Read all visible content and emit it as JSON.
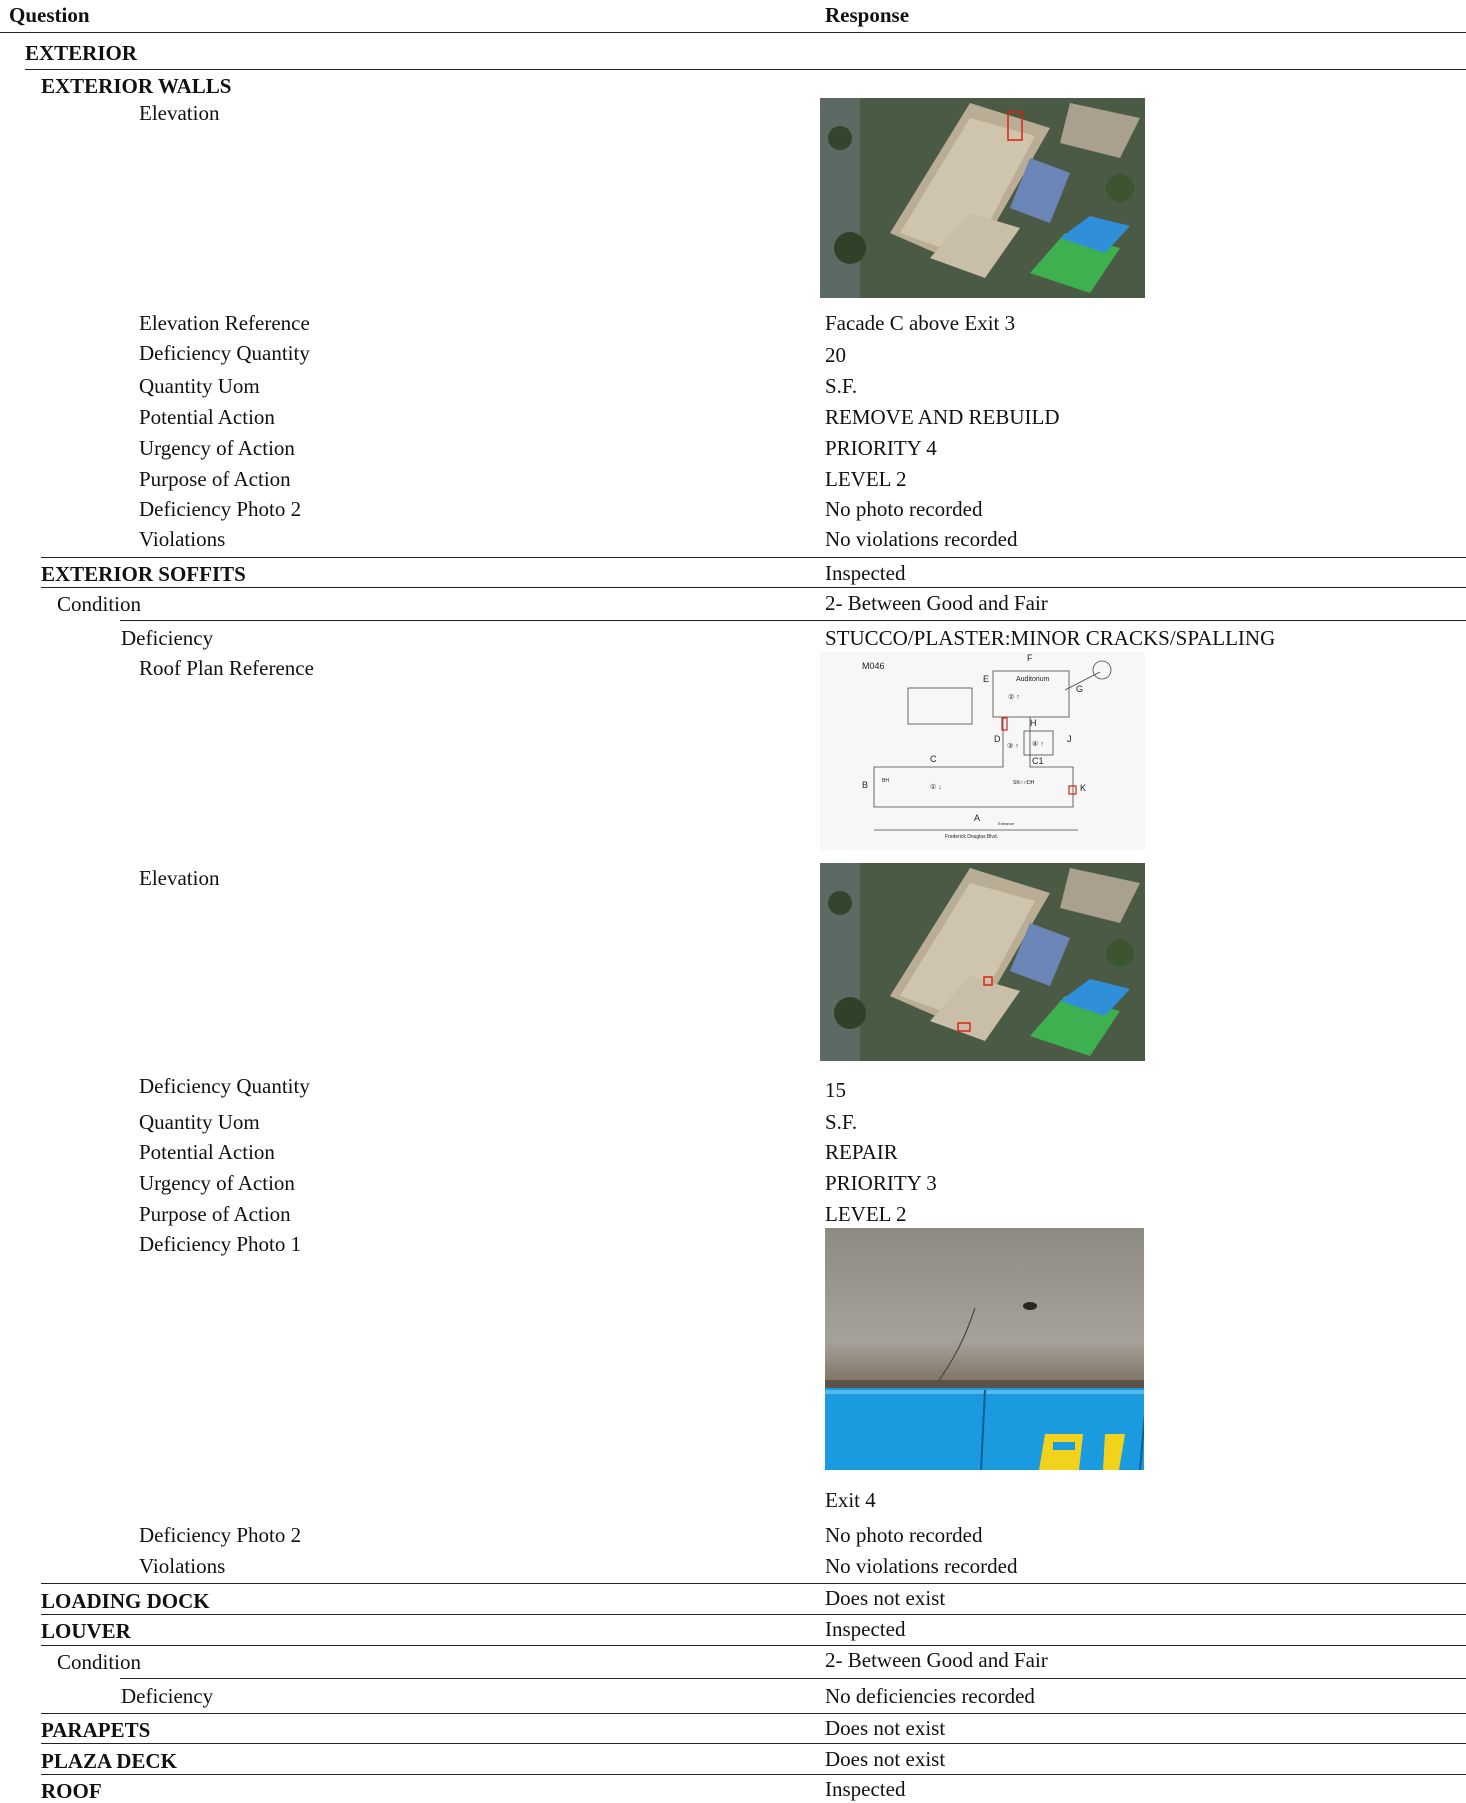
{
  "header": {
    "question": "Question",
    "response": "Response"
  },
  "sections": {
    "exterior": "EXTERIOR",
    "exterior_walls": {
      "title": "EXTERIOR WALLS",
      "elevation_label": "Elevation",
      "elevation_photo_icon": "aerial-photo",
      "fields": [
        {
          "label": "Elevation Reference",
          "value": "Facade C above Exit 3"
        },
        {
          "label": "Deficiency Quantity",
          "value": "20"
        },
        {
          "label": "Quantity Uom",
          "value": "S.F."
        },
        {
          "label": "Potential Action",
          "value": "REMOVE AND REBUILD"
        },
        {
          "label": "Urgency of Action",
          "value": "PRIORITY 4"
        },
        {
          "label": "Purpose of Action",
          "value": "LEVEL 2"
        },
        {
          "label": "Deficiency Photo 2",
          "value": "No photo recorded"
        },
        {
          "label": "Violations",
          "value": "No violations recorded"
        }
      ]
    },
    "exterior_soffits": {
      "title": "EXTERIOR SOFFITS",
      "status": "Inspected",
      "condition_label": "Condition",
      "condition_value": "2- Between Good and Fair",
      "deficiency_label": "Deficiency",
      "deficiency_value": "STUCCO/PLASTER:MINOR CRACKS/SPALLING",
      "roof_plan_label": "Roof Plan Reference",
      "roof_plan": {
        "code": "M046",
        "auditorium": "Auditorium",
        "letters": {
          "F": "F",
          "E": "E",
          "G": "G",
          "H": "H",
          "D": "D",
          "J": "J",
          "C": "C",
          "C1": "C1",
          "B": "B",
          "K": "K",
          "A": "A"
        },
        "bh": "BH",
        "sk": "SK□ □DH",
        "entrance": "Entrance",
        "street": "Frederick Douglas Blvd.",
        "roof_2": "② ↑",
        "roof_3": "③ ↑",
        "roof_4": "④ ↑",
        "roof_1": "① ↓"
      },
      "elevation_label": "Elevation",
      "fields": [
        {
          "label": "Deficiency Quantity",
          "value": "15"
        },
        {
          "label": "Quantity Uom",
          "value": "S.F."
        },
        {
          "label": "Potential Action",
          "value": "REPAIR"
        },
        {
          "label": "Urgency of Action",
          "value": "PRIORITY 3"
        },
        {
          "label": "Purpose of Action",
          "value": "LEVEL 2"
        }
      ],
      "photo1_label": "Deficiency Photo 1",
      "photo1_caption": "Exit 4",
      "photo2_label": "Deficiency Photo 2",
      "photo2_value": "No photo recorded",
      "violations_label": "Violations",
      "violations_value": "No violations recorded"
    },
    "loading_dock": {
      "title": "LOADING DOCK",
      "status": "Does not exist"
    },
    "louver": {
      "title": "LOUVER",
      "status": "Inspected",
      "condition_label": "Condition",
      "condition_value": "2- Between Good and Fair",
      "deficiency_label": "Deficiency",
      "deficiency_value": "No deficiencies recorded"
    },
    "parapets": {
      "title": "PARAPETS",
      "status": "Does not exist"
    },
    "plaza_deck": {
      "title": "PLAZA DECK",
      "status": "Does not exist"
    },
    "roof": {
      "title": "ROOF",
      "status": "Inspected"
    }
  }
}
